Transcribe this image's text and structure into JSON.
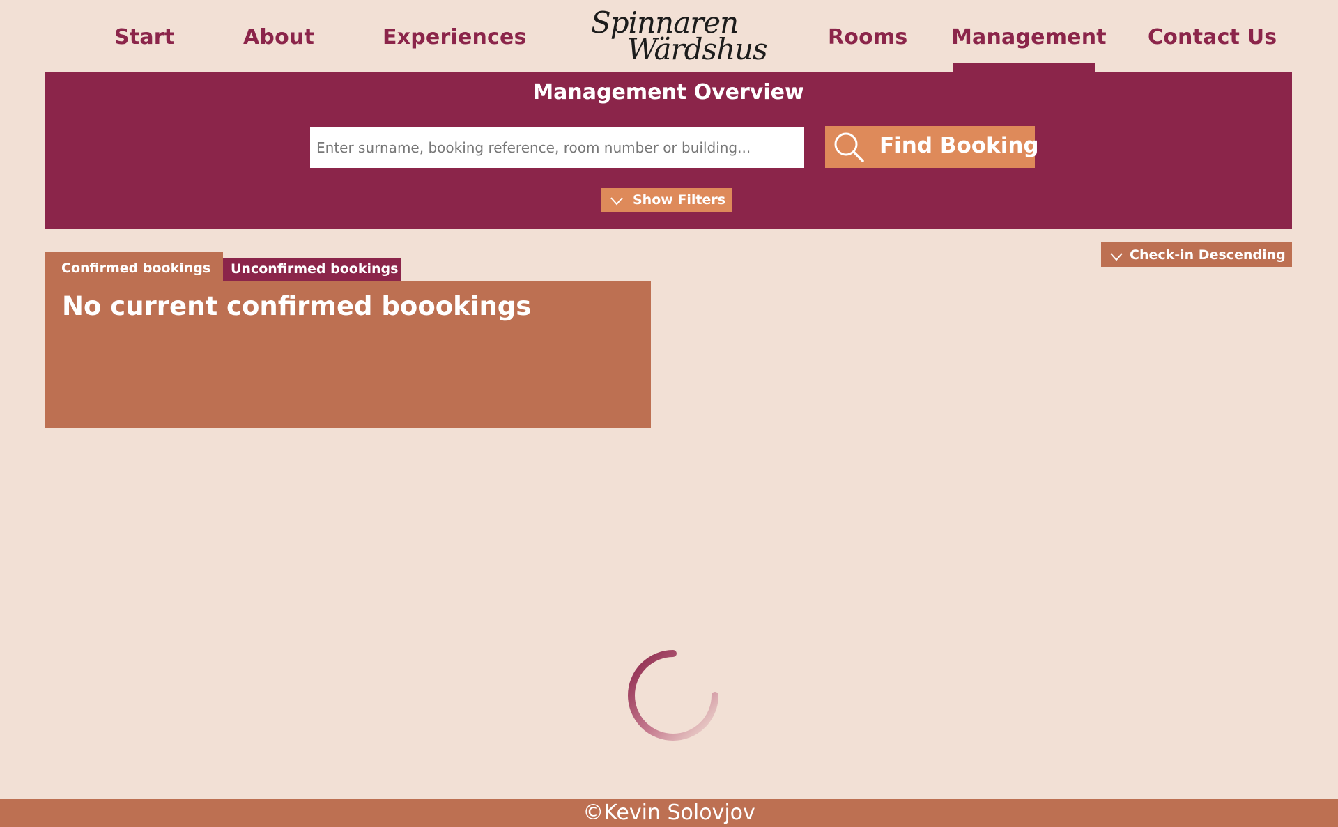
{
  "nav": {
    "items": [
      {
        "label": "Start"
      },
      {
        "label": "About"
      },
      {
        "label": "Experiences"
      },
      {
        "label": "Rooms"
      },
      {
        "label": "Management"
      },
      {
        "label": "Contact Us"
      }
    ],
    "active": "Management",
    "logo": {
      "line1": "Spinnaren",
      "line2": "Wärdshus"
    }
  },
  "banner": {
    "title": "Management Overview",
    "search": {
      "placeholder": "Enter surname, booking reference, room number or building...",
      "value": ""
    },
    "find_button": {
      "label": "Find Booking",
      "icon": "search-icon"
    },
    "filters_button": {
      "label": "Show Filters",
      "icon": "chevron-down-icon"
    }
  },
  "sort": {
    "label": "Check-in Descending",
    "icon": "chevron-down-icon"
  },
  "tabs": [
    {
      "label": "Confirmed bookings",
      "active": true
    },
    {
      "label": "Unconfirmed bookings",
      "active": false
    }
  ],
  "panel": {
    "message": "No current confirmed boookings"
  },
  "footer": {
    "text": "©Kevin Solovjov"
  },
  "colors": {
    "background": "#f2e0d5",
    "primary": "#8b254a",
    "accent": "#de8a5a",
    "secondary": "#bd7052",
    "text_light": "#ffffff"
  }
}
